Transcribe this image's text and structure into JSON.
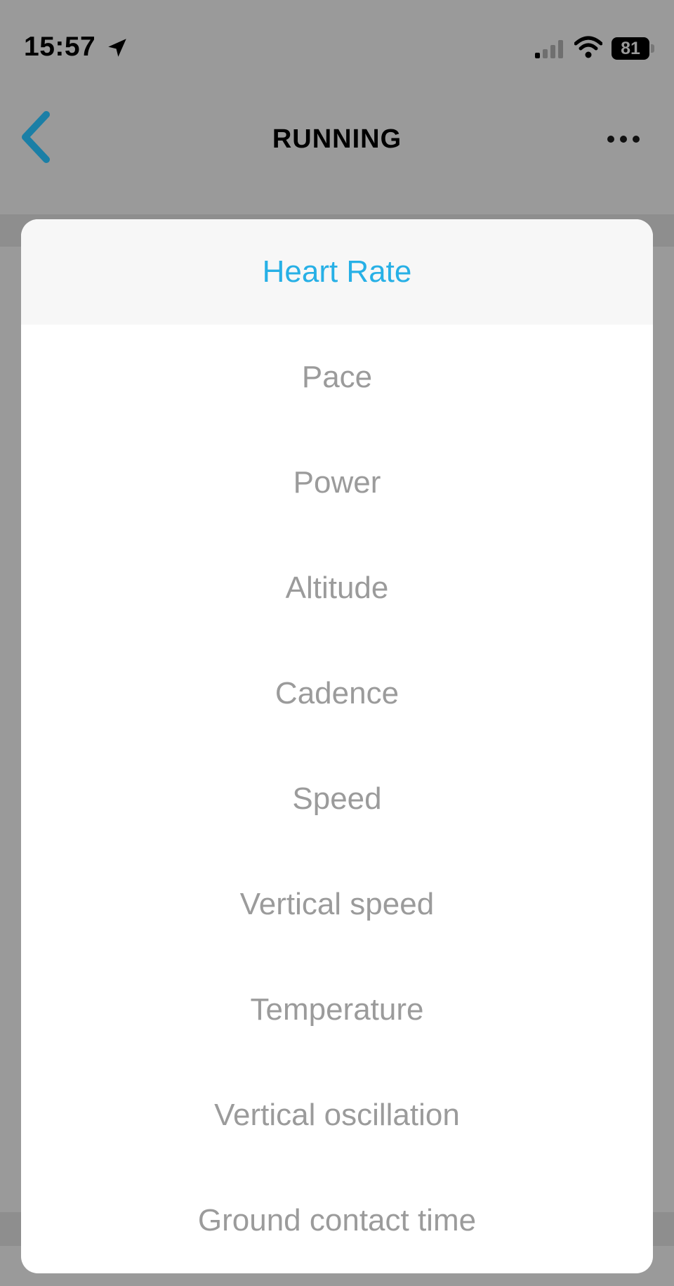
{
  "status_bar": {
    "time": "15:57",
    "battery": "81",
    "icons": [
      "location-arrow-icon",
      "cellular-signal-icon",
      "wifi-icon",
      "battery-icon"
    ]
  },
  "header": {
    "title": "RUNNING",
    "back_icon": "chevron-left-icon",
    "more_icon": "more-dots-icon"
  },
  "picker": {
    "selected_index": 0,
    "options": [
      "Heart Rate",
      "Pace",
      "Power",
      "Altitude",
      "Cadence",
      "Speed",
      "Vertical speed",
      "Temperature",
      "Vertical oscillation",
      "Ground contact time"
    ]
  },
  "colors": {
    "accent": "#27b0e6",
    "back_arrow": "#1b7fa6",
    "option_text": "#9b9b9b",
    "overlay_bg": "#9a9a9a"
  }
}
